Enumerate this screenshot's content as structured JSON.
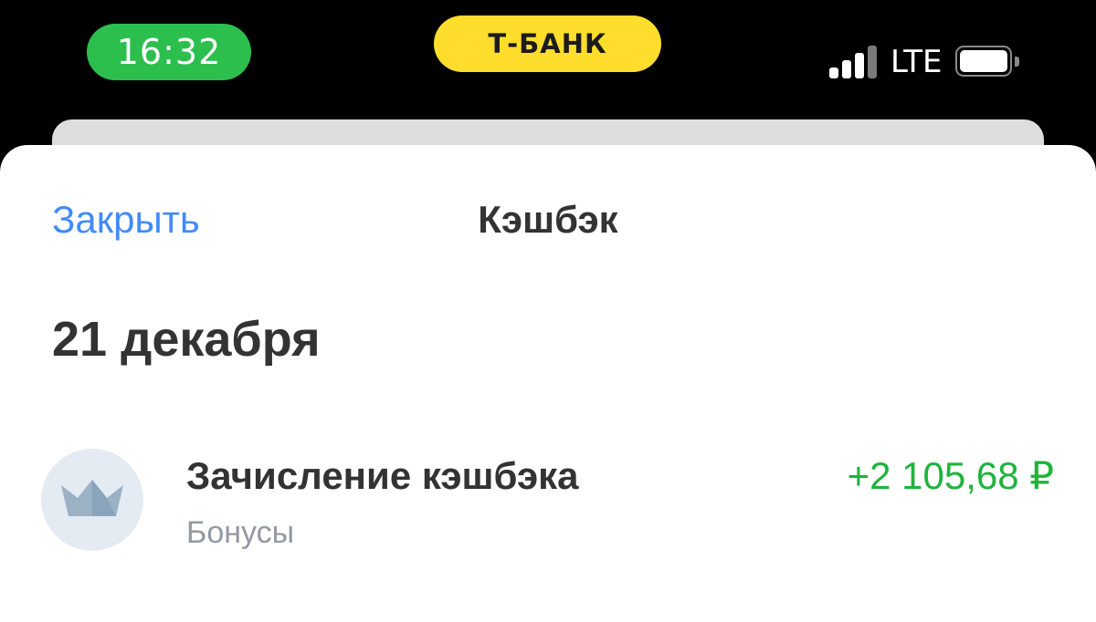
{
  "status_bar": {
    "time": "16:32",
    "bank_name": "Т-БАНК",
    "network": "LTE",
    "time_pill_color": "#2cbf4e",
    "bank_pill_color": "#ffdd2d"
  },
  "sheet": {
    "close_label": "Закрыть",
    "title": "Кэшбэк"
  },
  "date_header": "21 декабря",
  "transactions": [
    {
      "title": "Зачисление кэшбэка",
      "subtitle": "Бонусы",
      "amount": "+2 105,68 ₽",
      "icon": "crown-icon",
      "amount_color": "#1fb33c"
    }
  ],
  "colors": {
    "link": "#428bf9",
    "positive_amount": "#1fb33c",
    "muted_text": "#9299a2",
    "primary_text": "#333333"
  }
}
